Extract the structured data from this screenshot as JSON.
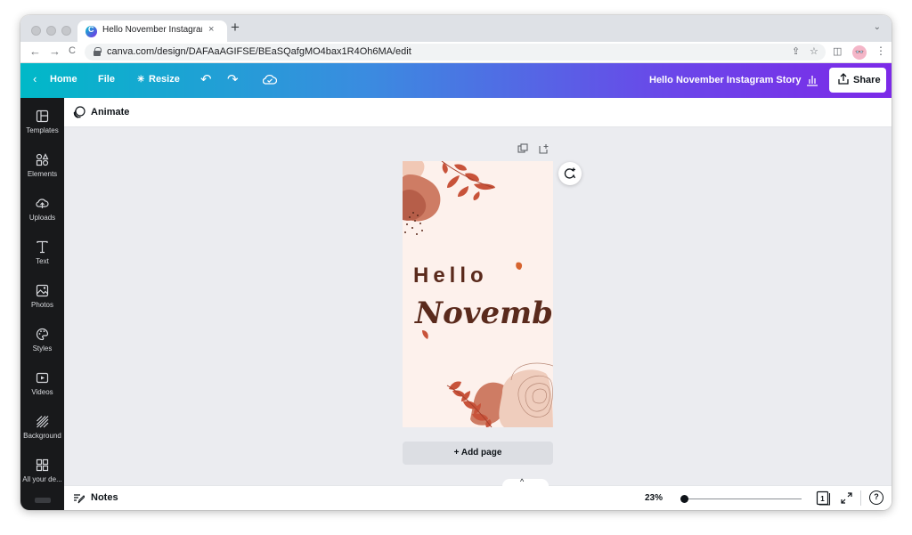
{
  "browser": {
    "tab_title": "Hello November Instagram Sto",
    "tab_close": "×",
    "new_tab": "+",
    "tab_menu": "⌄",
    "url": "canva.com/design/DAFAaAGIFSE/BEaSQafgMO4bax1R4Oh6MA/edit",
    "avatar_text": "👓",
    "nav_back": "←",
    "nav_forward": "→",
    "nav_reload": "C"
  },
  "topbar": {
    "home_label": "Home",
    "file_label": "File",
    "resize_label": "Resize",
    "doc_title": "Hello November Instagram Story",
    "share_label": "Share"
  },
  "sidebar": {
    "items": [
      {
        "label": "Templates",
        "icon": "templates-icon"
      },
      {
        "label": "Elements",
        "icon": "elements-icon"
      },
      {
        "label": "Uploads",
        "icon": "uploads-icon"
      },
      {
        "label": "Text",
        "icon": "text-icon"
      },
      {
        "label": "Photos",
        "icon": "photos-icon"
      },
      {
        "label": "Styles",
        "icon": "styles-icon"
      },
      {
        "label": "Videos",
        "icon": "videos-icon"
      },
      {
        "label": "Background",
        "icon": "background-icon"
      },
      {
        "label": "All your de...",
        "icon": "apps-icon"
      }
    ]
  },
  "toolbar": {
    "animate_label": "Animate"
  },
  "design": {
    "line1": "Hello",
    "line2": "November",
    "background_color": "#fdf1ec",
    "accent_color": "#c8533a",
    "text_color": "#5a2a1c"
  },
  "canvas": {
    "add_page_label": "+ Add page"
  },
  "bottombar": {
    "notes_label": "Notes",
    "zoom_label": "23%",
    "zoom_level_percent": 23,
    "page_count": "1",
    "help_label": "?",
    "collapse_chevron": "^"
  },
  "colors": {
    "brand_gradient_start": "#00b9c8",
    "brand_gradient_end": "#7c2ae8",
    "sidebar_bg": "#18191b",
    "canvas_bg": "#ebecf0"
  }
}
